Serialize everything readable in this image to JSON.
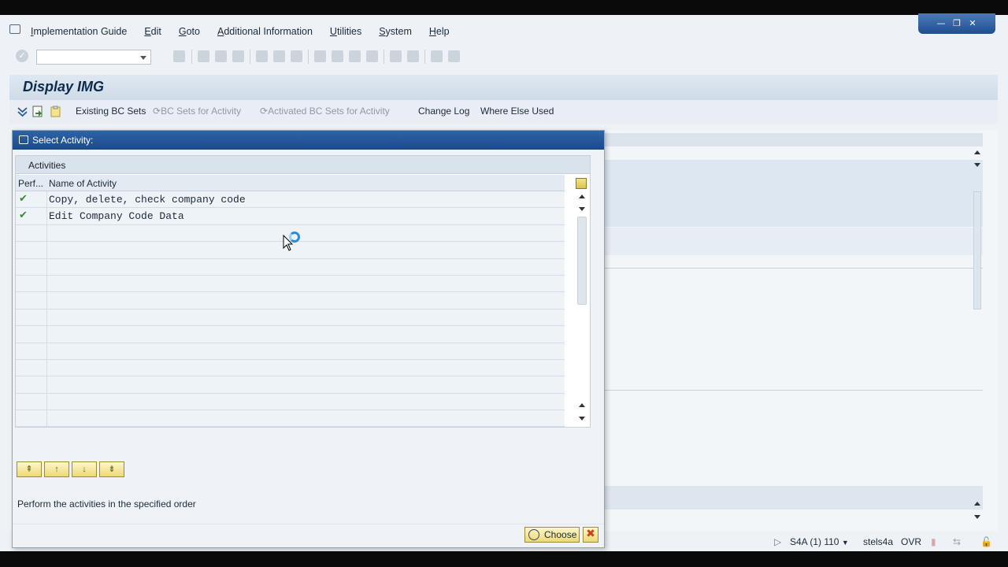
{
  "menu": {
    "items": [
      "Implementation Guide",
      "Edit",
      "Goto",
      "Additional Information",
      "Utilities",
      "System",
      "Help"
    ]
  },
  "window_controls": {
    "minimize": "—",
    "restore": "❐",
    "close": "✕"
  },
  "command_field": {
    "value": ""
  },
  "page": {
    "title": "Display IMG"
  },
  "app_toolbar": {
    "existing_bc_sets": "Existing BC Sets",
    "bc_sets_for_activity": "BC Sets for Activity",
    "activated_bc_sets": "Activated BC Sets for Activity",
    "change_log": "Change Log",
    "where_else_used": "Where Else Used"
  },
  "dialog": {
    "title": "Select Activity:",
    "table_title": "Activities",
    "columns": {
      "performed": "Perf...",
      "name": "Name of Activity"
    },
    "rows": [
      {
        "performed": "✔",
        "name": "Copy, delete, check company code"
      },
      {
        "performed": "✔",
        "name": "Edit Company Code Data"
      },
      {
        "performed": "",
        "name": ""
      },
      {
        "performed": "",
        "name": ""
      },
      {
        "performed": "",
        "name": ""
      },
      {
        "performed": "",
        "name": ""
      },
      {
        "performed": "",
        "name": ""
      },
      {
        "performed": "",
        "name": ""
      },
      {
        "performed": "",
        "name": ""
      },
      {
        "performed": "",
        "name": ""
      },
      {
        "performed": "",
        "name": ""
      },
      {
        "performed": "",
        "name": ""
      },
      {
        "performed": "",
        "name": ""
      },
      {
        "performed": "",
        "name": ""
      }
    ],
    "hint": "Perform the activities in the specified order",
    "choose_label": "Choose",
    "cancel_label": "✖"
  },
  "status": {
    "system": "S4A (1) 110",
    "server": "stels4a",
    "mode": "OVR"
  },
  "colors": {
    "dialog_title_bg": "#1b4a89",
    "check_green": "#3a8a2a",
    "button_yellow": "#ecd977",
    "cancel_red": "#d2421a"
  }
}
